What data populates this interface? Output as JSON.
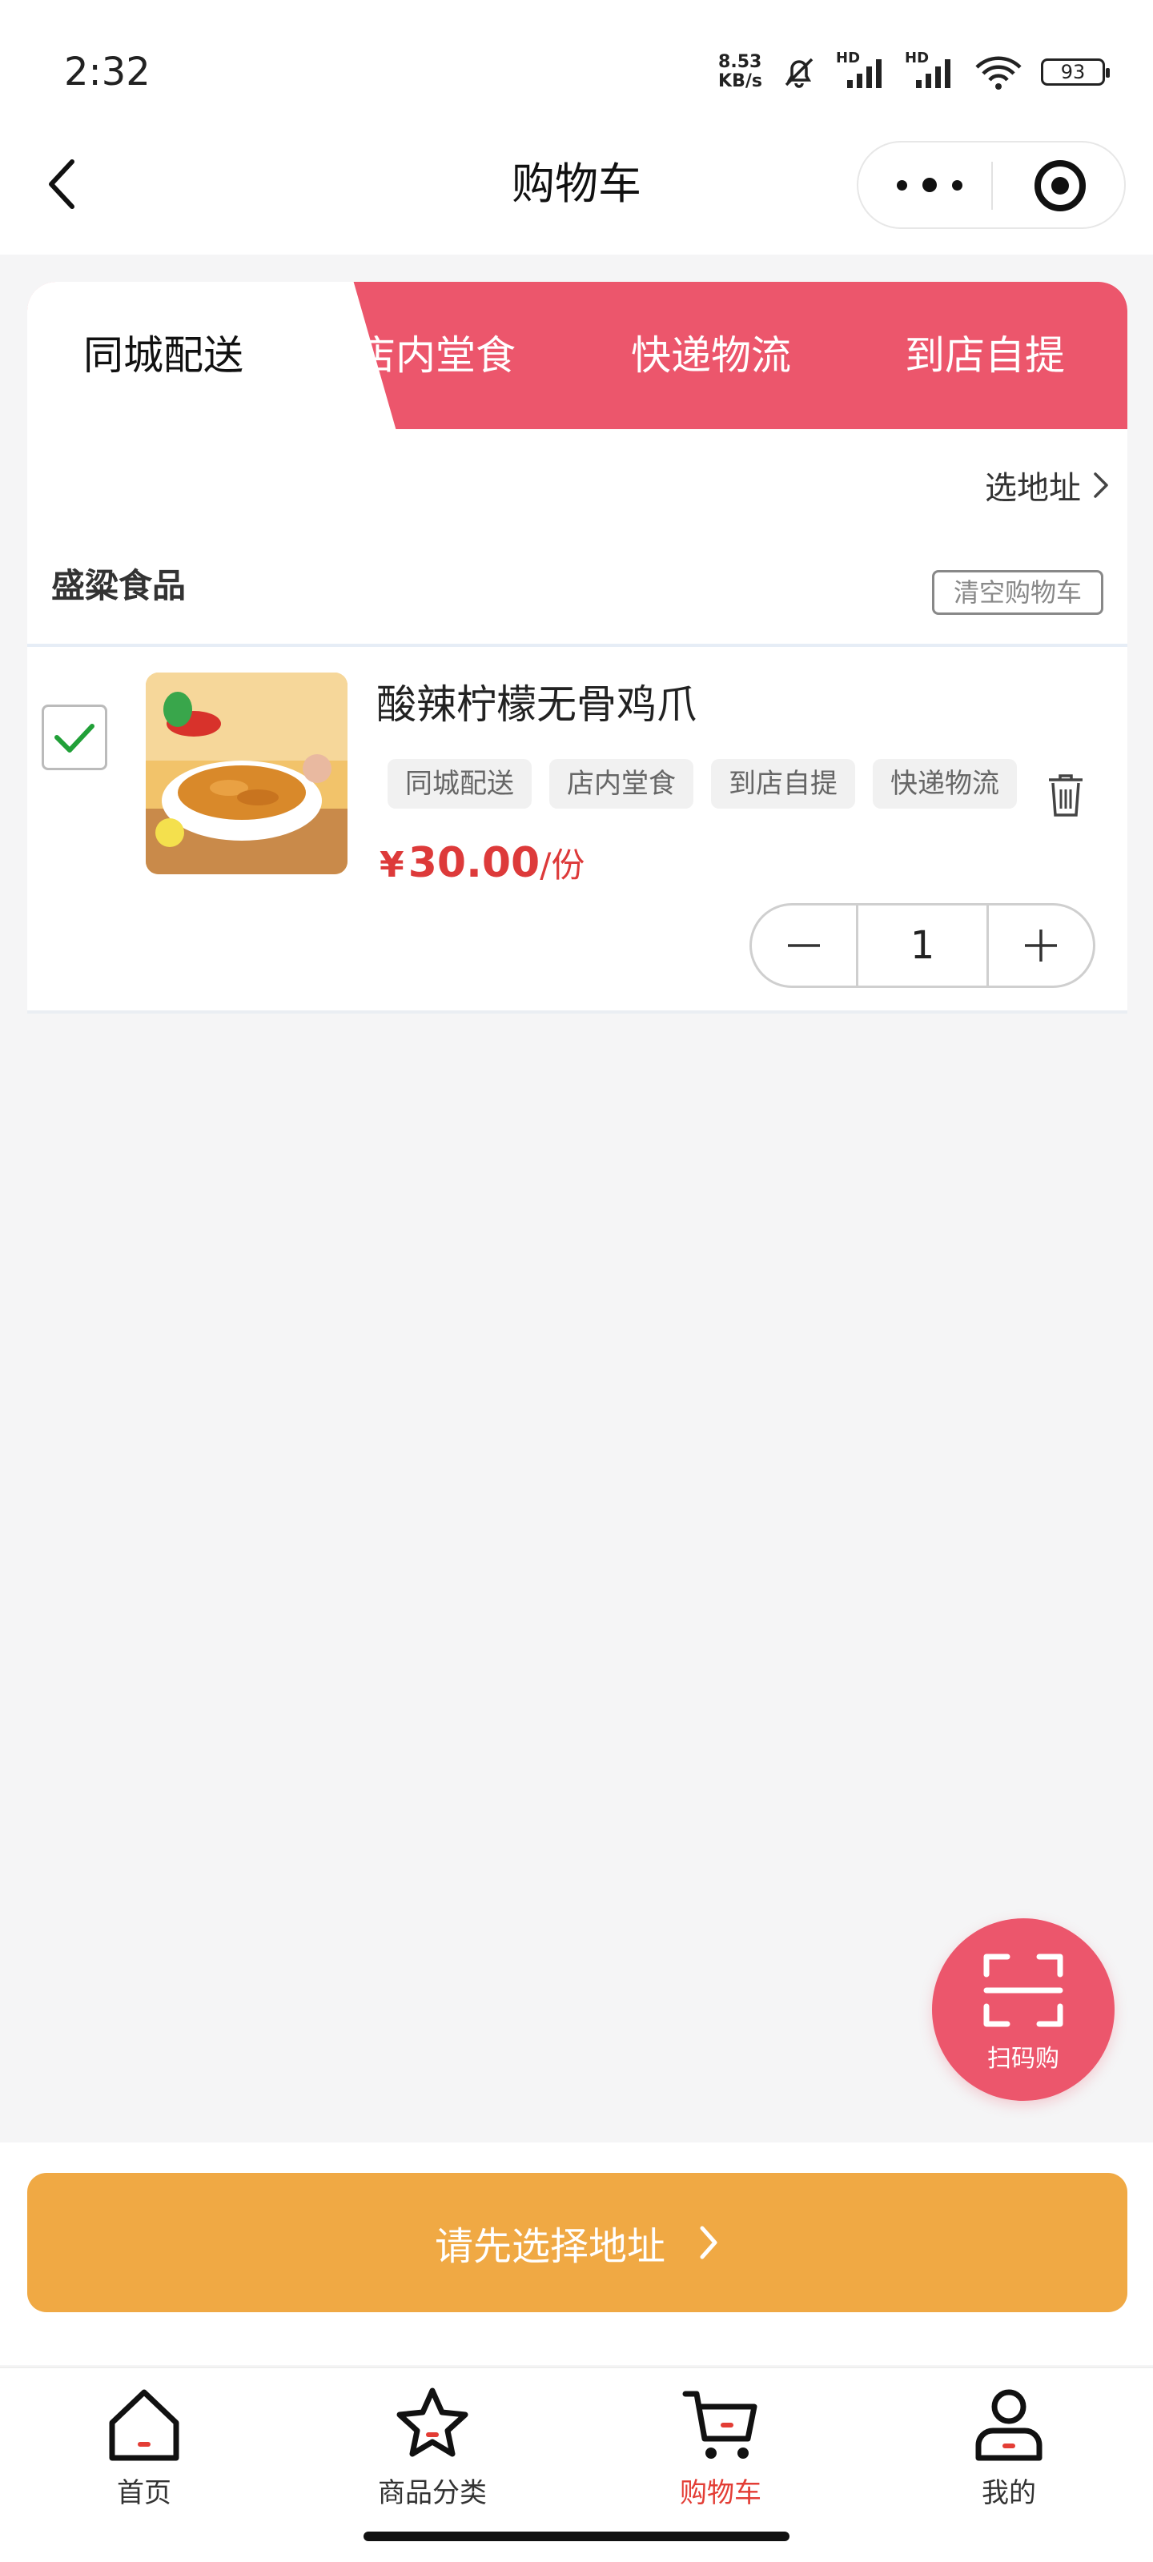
{
  "status_bar": {
    "time": "2:32",
    "net_speed_value": "8.53",
    "net_speed_unit": "KB/s",
    "signal_labels": [
      "HD",
      "HD"
    ],
    "battery": "93"
  },
  "nav": {
    "title": "购物车"
  },
  "delivery_tabs": [
    {
      "label": "同城配送",
      "active": true
    },
    {
      "label": "店内堂食",
      "active": false
    },
    {
      "label": "快递物流",
      "active": false
    },
    {
      "label": "到店自提",
      "active": false
    }
  ],
  "address": {
    "label": "选地址"
  },
  "store": {
    "name": "盛粱食品",
    "clear_label": "清空购物车"
  },
  "item": {
    "name": "酸辣柠檬无骨鸡爪",
    "checked": true,
    "tags": [
      "同城配送",
      "店内堂食",
      "到店自提",
      "快递物流"
    ],
    "currency": "¥",
    "price": "30.00",
    "unit": "/份",
    "quantity": "1"
  },
  "scan": {
    "label": "扫码购"
  },
  "action": {
    "label": "请先选择地址"
  },
  "tabbar": [
    {
      "label": "首页",
      "icon": "home-icon",
      "active": false
    },
    {
      "label": "商品分类",
      "icon": "star-icon",
      "active": false
    },
    {
      "label": "购物车",
      "icon": "cart-icon",
      "active": true
    },
    {
      "label": "我的",
      "icon": "profile-icon",
      "active": false
    }
  ],
  "colors": {
    "accent_red": "#ec566c",
    "price_red": "#dd3a3a",
    "primary_button": "#f0a944",
    "active_tab_label": "#e33d35"
  }
}
